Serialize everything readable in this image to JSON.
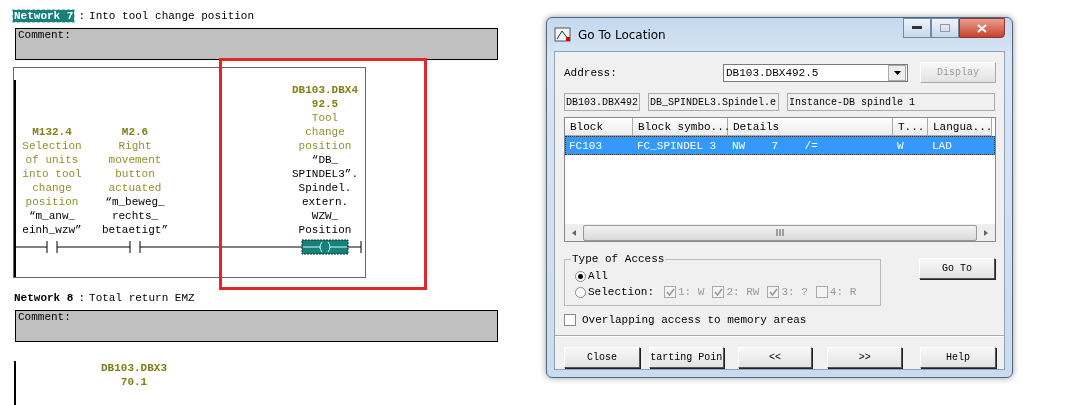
{
  "networks": [
    {
      "title": "Network 7",
      "selected": true,
      "separator": ":",
      "description": "Into tool change position",
      "comment_label": "Comment:",
      "elements": [
        {
          "kind": "contact",
          "address_lines": [
            "M132.4"
          ],
          "comment_lines": [
            "Selection",
            "of units",
            "into tool",
            "change",
            "position"
          ],
          "symbol_lines": [
            "“m_anw_",
            "einh_wzw”"
          ]
        },
        {
          "kind": "contact",
          "address_lines": [
            "M2.6"
          ],
          "comment_lines": [
            "Right",
            "movement",
            "button",
            "actuated"
          ],
          "symbol_lines": [
            "“m_beweg_",
            "rechts_",
            "betaetigt”"
          ]
        },
        {
          "kind": "coil",
          "address_lines": [
            "DB103.DBX4",
            "92.5"
          ],
          "comment_lines": [
            "Tool",
            "change",
            "position"
          ],
          "symbol_lines": [
            "“DB_",
            "SPINDEL3”.",
            "Spindel.",
            "extern.",
            "WZW_",
            "Position"
          ]
        }
      ]
    },
    {
      "title": "Network 8",
      "selected": false,
      "separator": ":",
      "description": "Total return EMZ",
      "comment_label": "Comment:",
      "elements": [
        {
          "address_lines": [
            "DB103.DBX3",
            "70.1"
          ]
        }
      ]
    }
  ],
  "dialog": {
    "title": "Go To Location",
    "address_label": "Address:",
    "address_value": "DB103.DBX492.5",
    "display_button": {
      "label": "Display",
      "disabled": true
    },
    "info_fields": [
      "DB103.DBX492",
      "DB_SPINDEL3.Spindel.e",
      "Instance-DB spindle 1"
    ],
    "table": {
      "columns": [
        "Block",
        "Block symbo...",
        "Details",
        "T...",
        "Langua..."
      ],
      "rows": [
        {
          "selected": true,
          "cells": [
            "FC103",
            "FC_SPINDEL 3",
            "NW    7    /=",
            "W",
            "LAD"
          ]
        }
      ]
    },
    "access_group": {
      "title": "Type of Access",
      "options": [
        {
          "label": "All",
          "selected": true
        },
        {
          "label": "Selection:",
          "selected": false
        }
      ],
      "checks": [
        {
          "label": "1: W",
          "checked": true
        },
        {
          "label": "2: RW",
          "checked": true
        },
        {
          "label": "3: ?",
          "checked": true
        },
        {
          "label": "4: R",
          "checked": false
        }
      ]
    },
    "goto_button": "Go To",
    "overlap": {
      "label": "Overlapping access to memory areas",
      "checked": false
    },
    "buttons": [
      "Close",
      "tarting Poin",
      "<<",
      ">>",
      "Help"
    ]
  }
}
